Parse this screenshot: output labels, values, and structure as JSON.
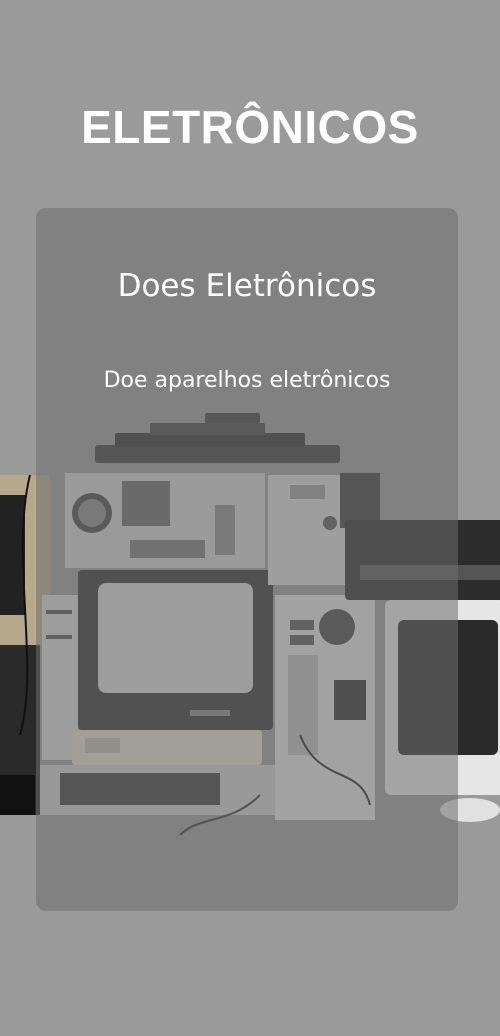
{
  "header": {
    "title": "ELETRÔNICOS"
  },
  "card": {
    "title": "Does Eletrônicos",
    "subtitle": "Doe aparelhos eletrônicos"
  },
  "colors": {
    "background": "#9a9a9a",
    "card": "#6e6e6e",
    "text": "#ffffff"
  }
}
